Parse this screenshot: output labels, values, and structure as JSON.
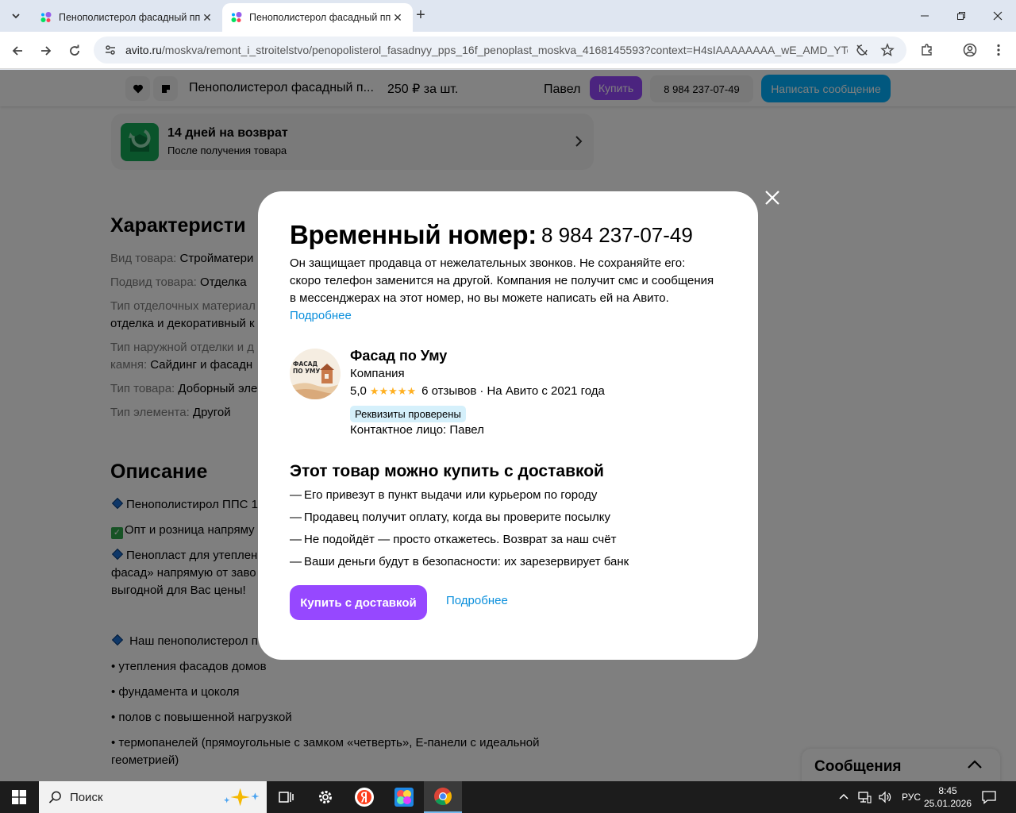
{
  "browser": {
    "tabs": [
      {
        "title": "Пенополистерол фасадный пп",
        "active": false
      },
      {
        "title": "Пенополистерол фасадный пп",
        "active": true
      }
    ],
    "url_host": "avito.ru",
    "url_path": "/moskva/remont_i_stroitelstvo/penopolisterol_fasadnyy_pps_16f_penoplast_moskva_4168145593?context=H4sIAAAAAAAA_wE_AMD_YToy..."
  },
  "sticky": {
    "title": "Пенополистерол фасадный п...",
    "price": "250 ₽ за шт.",
    "seller": "Павел",
    "buy_label": "Купить",
    "phone": "8 984 237-07-49",
    "message_label": "Написать сообщение"
  },
  "return_card": {
    "title": "14 дней на возврат",
    "subtitle": "После получения товара"
  },
  "characteristics": {
    "heading": "Характеристи",
    "items": [
      {
        "key": "Вид товара: ",
        "value": "Стройматери"
      },
      {
        "key": "Подвид товара: ",
        "value": "Отделка"
      },
      {
        "key": "Тип отделочных материал",
        "value": "отделка и декоративный к"
      },
      {
        "key": "Тип наружной отделки и д",
        "key2": "камня: ",
        "value": "Сайдинг и фасадн"
      },
      {
        "key": "Тип товара: ",
        "value": "Доборный эле"
      },
      {
        "key": "Тип элемента: ",
        "value": "Другой"
      }
    ]
  },
  "description": {
    "heading": "Описание",
    "line1": "Пенополистирол ППС 1",
    "line2": "Опт и розница напряму",
    "line3": "Пенопласт для утеплен",
    "line3b": "фасад» напрямую от заво",
    "line3c": "выгодной для Вас цены!",
    "line4": " Наш пенополистерол п",
    "bullets": [
      "• утепления фасадов домов",
      "• фундамента и цоколя",
      "• полов с повышенной нагрузкой",
      "• термопанелей (прямоугольные с замком «четверть», Е-панели с идеальной геометрией)"
    ]
  },
  "messages_panel": {
    "label": "Сообщения"
  },
  "modal": {
    "title": "Временный номер:",
    "number": "8 984 237-07-49",
    "text": "Он защищает продавца от нежелательных звонков. Не сохраняйте его: скоро телефон заменится на другой. Компания не получит смс и сообщения в мессенджерах на этот номер, но вы можете написать ей на Авито.",
    "text_link": "Подробнее",
    "seller_name": "Фасад по Уму",
    "seller_type": "Компания",
    "rating": "5,0",
    "reviews": "6 отзывов",
    "since": "· На Авито с 2021 года",
    "badge": "Реквизиты проверены",
    "contact": "Контактное лицо: Павел",
    "logo_text": "ФАСАД ПО УМУ",
    "delivery_heading": "Этот товар можно купить с доставкой",
    "delivery_items": [
      "Его привезут в пункт выдачи или курьером по городу",
      "Продавец получит оплату, когда вы проверите посылку",
      "Не подойдёт — просто откажетесь. Возврат за наш счёт",
      "Ваши деньги будут в безопасности: их зарезервирует банк"
    ],
    "buy_label": "Купить с доставкой",
    "more_label": "Подробнее"
  },
  "taskbar": {
    "search_label": "Поиск",
    "lang": "РУС",
    "time": "8:45",
    "date": "25.01.2026"
  },
  "colors": {
    "accent_purple": "#9648ff",
    "accent_blue": "#02b1ff",
    "link": "#0a8fdc"
  }
}
